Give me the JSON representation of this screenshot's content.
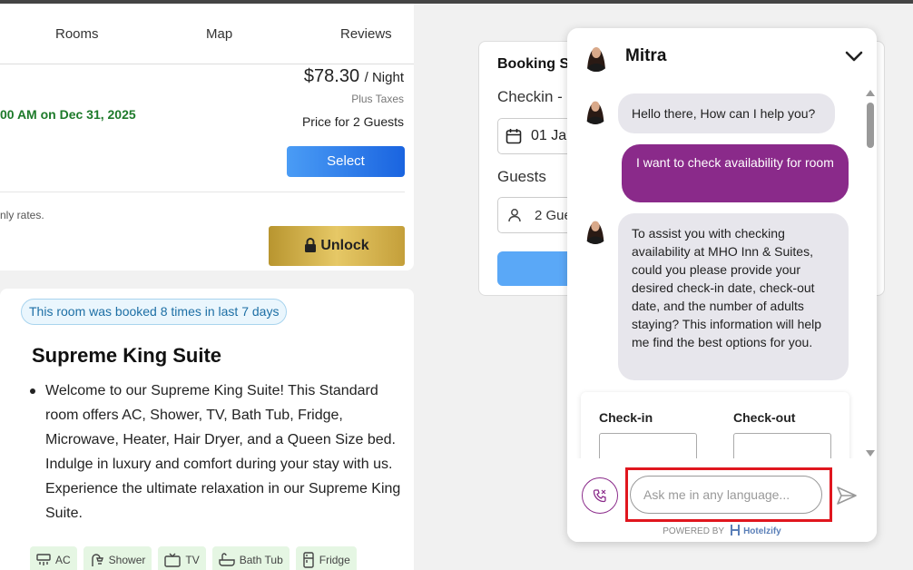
{
  "nav": {
    "tabs": [
      "Rooms",
      "Map",
      "Reviews"
    ]
  },
  "rate": {
    "price": "$78.30",
    "unit": "/ Night",
    "taxes": "Plus Taxes",
    "guests_note": "Price for 2 Guests",
    "date_note": "00 AM on Dec 31, 2025",
    "select_label": "Select",
    "rates_note": "nly rates.",
    "unlock_label": "Unlock"
  },
  "room": {
    "badge": "This room was booked 8 times in last 7 days",
    "title": "Supreme King Suite",
    "description": "Welcome to our Supreme King Suite! This Standard room offers AC, Shower, TV, Bath Tub, Fridge, Microwave, Heater, Hair Dryer, and a Queen Size bed. Indulge in luxury and comfort during your stay with us. Experience the ultimate relaxation in our Supreme King Suite.",
    "amenities": [
      {
        "label": "AC",
        "icon": "ac-icon"
      },
      {
        "label": "Shower",
        "icon": "shower-icon"
      },
      {
        "label": "TV",
        "icon": "tv-icon"
      },
      {
        "label": "Bath Tub",
        "icon": "bathtub-icon"
      },
      {
        "label": "Fridge",
        "icon": "fridge-icon"
      }
    ]
  },
  "booking": {
    "title": "Booking S",
    "checkin_label": "Checkin - (",
    "date_value": "01 Jar",
    "guests_label": "Guests",
    "guests_value": "2 Gue"
  },
  "chat": {
    "agent_name": "Mitra",
    "messages": [
      {
        "from": "bot",
        "text": "Hello there, How can I help you?"
      },
      {
        "from": "user",
        "text": "I want to check availability for room"
      },
      {
        "from": "bot",
        "text": "To assist you with checking availability at MHO Inn & Suites, could you please provide your desired check-in date, check-out date, and the number of adults staying? This information will help me find the best options for you."
      }
    ],
    "form": {
      "checkin_label": "Check-in",
      "checkout_label": "Check-out"
    },
    "input_placeholder": "Ask me in any language...",
    "powered_by": "POWERED BY",
    "brand": "Hotelzify",
    "accent_color": "#8a2a8a"
  }
}
